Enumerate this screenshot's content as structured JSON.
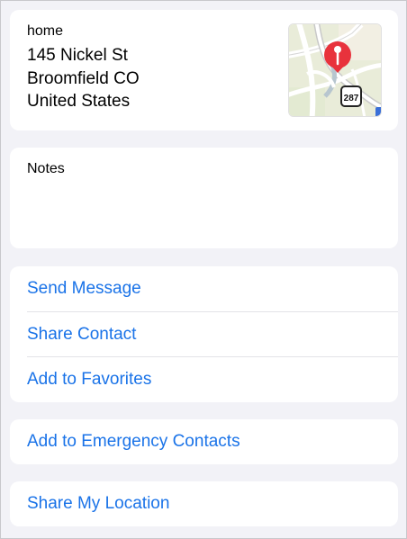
{
  "address": {
    "label": "home",
    "line1": "145 Nickel St",
    "line2": "Broomfield  CO",
    "line3": "United States",
    "map_route_sign": "287"
  },
  "notes": {
    "label": "Notes"
  },
  "actions": [
    {
      "label": "Send Message"
    },
    {
      "label": "Share Contact"
    },
    {
      "label": "Add to Favorites"
    }
  ],
  "emergency": {
    "label": "Add to Emergency Contacts"
  },
  "location": {
    "label": "Share My Location"
  },
  "colors": {
    "background": "#f2f2f7",
    "card": "#ffffff",
    "link": "#1a73e8",
    "pin": "#e8323c"
  }
}
